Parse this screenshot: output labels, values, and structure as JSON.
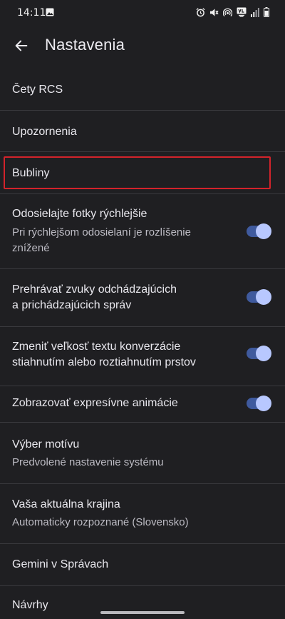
{
  "status_bar": {
    "time": "14:11",
    "left_icon": "image-icon",
    "right_icons": [
      "alarm-icon",
      "mute-icon",
      "hotspot-icon",
      "volte-icon",
      "signal-icon",
      "battery-icon"
    ]
  },
  "app_bar": {
    "back_icon": "arrow-left-icon",
    "title": "Nastavenia"
  },
  "settings": {
    "rcs_chats": {
      "title": "Čety RCS"
    },
    "notifications": {
      "title": "Upozornenia"
    },
    "bubbles": {
      "title": "Bubliny"
    },
    "send_photos_faster": {
      "title": "Odosielajte fotky rýchlejšie",
      "subtitle_line1": "Pri rýchlejšom odosielaní je rozlíšenie",
      "subtitle_line2": "znížené",
      "enabled": true
    },
    "play_sounds": {
      "title_line1": "Prehrávať zvuky odchádzajúcich",
      "title_line2": "a prichádzajúcich správ",
      "enabled": true
    },
    "pinch_text_size": {
      "title_line1": "Zmeniť veľkosť textu konverzácie",
      "title_line2": "stiahnutím alebo roztiahnutím prstov",
      "enabled": true
    },
    "expressive_animations": {
      "title": "Zobrazovať expresívne animácie",
      "enabled": true
    },
    "theme": {
      "title": "Výber motívu",
      "subtitle": "Predvolené nastavenie systému"
    },
    "country": {
      "title": "Vaša aktuálna krajina",
      "subtitle": "Automaticky rozpoznané (Slovensko)"
    },
    "gemini": {
      "title": "Gemini v Správach"
    },
    "suggestions": {
      "title": "Návrhy"
    }
  },
  "colors": {
    "background": "#1f1f22",
    "toggle_track": "#3f5a9e",
    "toggle_thumb": "#b8c8ff",
    "highlight": "#d3232b"
  }
}
